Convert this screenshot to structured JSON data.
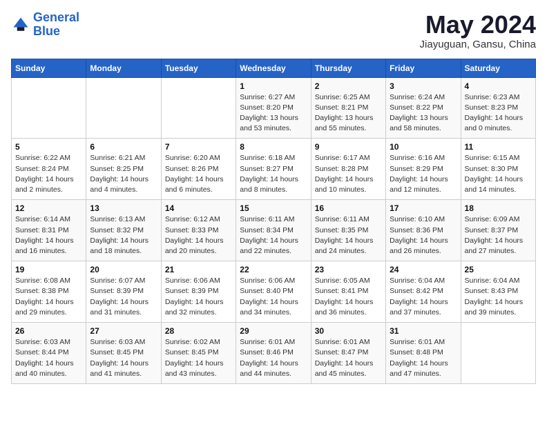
{
  "header": {
    "logo_line1": "General",
    "logo_line2": "Blue",
    "month": "May 2024",
    "location": "Jiayuguan, Gansu, China"
  },
  "weekdays": [
    "Sunday",
    "Monday",
    "Tuesday",
    "Wednesday",
    "Thursday",
    "Friday",
    "Saturday"
  ],
  "weeks": [
    [
      {
        "day": "",
        "info": ""
      },
      {
        "day": "",
        "info": ""
      },
      {
        "day": "",
        "info": ""
      },
      {
        "day": "1",
        "info": "Sunrise: 6:27 AM\nSunset: 8:20 PM\nDaylight: 13 hours\nand 53 minutes."
      },
      {
        "day": "2",
        "info": "Sunrise: 6:25 AM\nSunset: 8:21 PM\nDaylight: 13 hours\nand 55 minutes."
      },
      {
        "day": "3",
        "info": "Sunrise: 6:24 AM\nSunset: 8:22 PM\nDaylight: 13 hours\nand 58 minutes."
      },
      {
        "day": "4",
        "info": "Sunrise: 6:23 AM\nSunset: 8:23 PM\nDaylight: 14 hours\nand 0 minutes."
      }
    ],
    [
      {
        "day": "5",
        "info": "Sunrise: 6:22 AM\nSunset: 8:24 PM\nDaylight: 14 hours\nand 2 minutes."
      },
      {
        "day": "6",
        "info": "Sunrise: 6:21 AM\nSunset: 8:25 PM\nDaylight: 14 hours\nand 4 minutes."
      },
      {
        "day": "7",
        "info": "Sunrise: 6:20 AM\nSunset: 8:26 PM\nDaylight: 14 hours\nand 6 minutes."
      },
      {
        "day": "8",
        "info": "Sunrise: 6:18 AM\nSunset: 8:27 PM\nDaylight: 14 hours\nand 8 minutes."
      },
      {
        "day": "9",
        "info": "Sunrise: 6:17 AM\nSunset: 8:28 PM\nDaylight: 14 hours\nand 10 minutes."
      },
      {
        "day": "10",
        "info": "Sunrise: 6:16 AM\nSunset: 8:29 PM\nDaylight: 14 hours\nand 12 minutes."
      },
      {
        "day": "11",
        "info": "Sunrise: 6:15 AM\nSunset: 8:30 PM\nDaylight: 14 hours\nand 14 minutes."
      }
    ],
    [
      {
        "day": "12",
        "info": "Sunrise: 6:14 AM\nSunset: 8:31 PM\nDaylight: 14 hours\nand 16 minutes."
      },
      {
        "day": "13",
        "info": "Sunrise: 6:13 AM\nSunset: 8:32 PM\nDaylight: 14 hours\nand 18 minutes."
      },
      {
        "day": "14",
        "info": "Sunrise: 6:12 AM\nSunset: 8:33 PM\nDaylight: 14 hours\nand 20 minutes."
      },
      {
        "day": "15",
        "info": "Sunrise: 6:11 AM\nSunset: 8:34 PM\nDaylight: 14 hours\nand 22 minutes."
      },
      {
        "day": "16",
        "info": "Sunrise: 6:11 AM\nSunset: 8:35 PM\nDaylight: 14 hours\nand 24 minutes."
      },
      {
        "day": "17",
        "info": "Sunrise: 6:10 AM\nSunset: 8:36 PM\nDaylight: 14 hours\nand 26 minutes."
      },
      {
        "day": "18",
        "info": "Sunrise: 6:09 AM\nSunset: 8:37 PM\nDaylight: 14 hours\nand 27 minutes."
      }
    ],
    [
      {
        "day": "19",
        "info": "Sunrise: 6:08 AM\nSunset: 8:38 PM\nDaylight: 14 hours\nand 29 minutes."
      },
      {
        "day": "20",
        "info": "Sunrise: 6:07 AM\nSunset: 8:39 PM\nDaylight: 14 hours\nand 31 minutes."
      },
      {
        "day": "21",
        "info": "Sunrise: 6:06 AM\nSunset: 8:39 PM\nDaylight: 14 hours\nand 32 minutes."
      },
      {
        "day": "22",
        "info": "Sunrise: 6:06 AM\nSunset: 8:40 PM\nDaylight: 14 hours\nand 34 minutes."
      },
      {
        "day": "23",
        "info": "Sunrise: 6:05 AM\nSunset: 8:41 PM\nDaylight: 14 hours\nand 36 minutes."
      },
      {
        "day": "24",
        "info": "Sunrise: 6:04 AM\nSunset: 8:42 PM\nDaylight: 14 hours\nand 37 minutes."
      },
      {
        "day": "25",
        "info": "Sunrise: 6:04 AM\nSunset: 8:43 PM\nDaylight: 14 hours\nand 39 minutes."
      }
    ],
    [
      {
        "day": "26",
        "info": "Sunrise: 6:03 AM\nSunset: 8:44 PM\nDaylight: 14 hours\nand 40 minutes."
      },
      {
        "day": "27",
        "info": "Sunrise: 6:03 AM\nSunset: 8:45 PM\nDaylight: 14 hours\nand 41 minutes."
      },
      {
        "day": "28",
        "info": "Sunrise: 6:02 AM\nSunset: 8:45 PM\nDaylight: 14 hours\nand 43 minutes."
      },
      {
        "day": "29",
        "info": "Sunrise: 6:01 AM\nSunset: 8:46 PM\nDaylight: 14 hours\nand 44 minutes."
      },
      {
        "day": "30",
        "info": "Sunrise: 6:01 AM\nSunset: 8:47 PM\nDaylight: 14 hours\nand 45 minutes."
      },
      {
        "day": "31",
        "info": "Sunrise: 6:01 AM\nSunset: 8:48 PM\nDaylight: 14 hours\nand 47 minutes."
      },
      {
        "day": "",
        "info": ""
      }
    ]
  ]
}
